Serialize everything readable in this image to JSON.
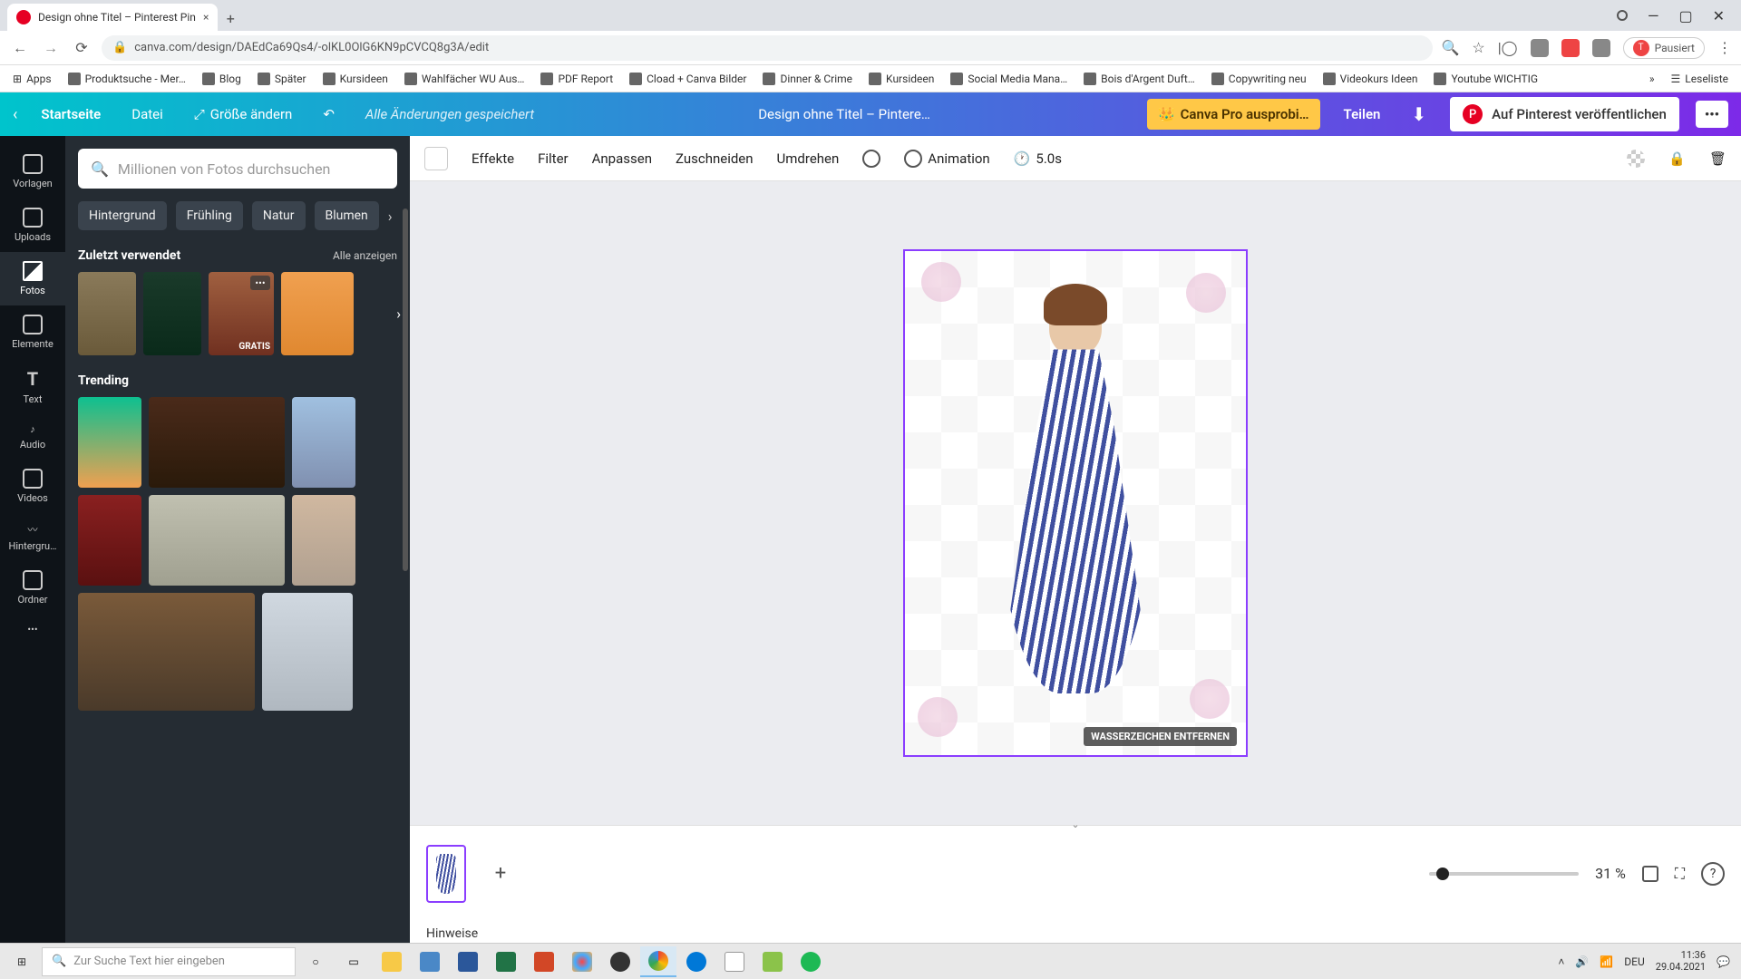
{
  "browser": {
    "tab_title": "Design ohne Titel – Pinterest Pin",
    "url": "canva.com/design/DAEdCa69Qs4/-olKL0OlG6KN9pCVCQ8g3A/edit",
    "pause_label": "Pausiert",
    "bookmarks": [
      "Apps",
      "Produktsuche - Mer…",
      "Blog",
      "Später",
      "Kursideen",
      "Wahlfächer WU Aus…",
      "PDF Report",
      "Cload + Canva Bilder",
      "Dinner & Crime",
      "Kursideen",
      "Social Media Mana…",
      "Bois d'Argent Duft…",
      "Copywriting neu",
      "Videokurs Ideen",
      "Youtube WICHTIG"
    ],
    "bm_right": "Leseliste"
  },
  "canva": {
    "home": "Startseite",
    "file": "Datei",
    "resize": "Größe ändern",
    "save_status": "Alle Änderungen gespeichert",
    "doc_title": "Design ohne Titel – Pintere…",
    "pro": "Canva Pro ausprobi…",
    "share": "Teilen",
    "publish": "Auf Pinterest veröffentlichen",
    "rail": {
      "templates": "Vorlagen",
      "uploads": "Uploads",
      "photos": "Fotos",
      "elements": "Elemente",
      "text": "Text",
      "audio": "Audio",
      "videos": "Videos",
      "background": "Hintergru…",
      "folder": "Ordner"
    },
    "panel": {
      "search_placeholder": "Millionen von Fotos durchsuchen",
      "chips": [
        "Hintergrund",
        "Frühling",
        "Natur",
        "Blumen"
      ],
      "recent_title": "Zuletzt verwendet",
      "see_all": "Alle anzeigen",
      "gratis": "GRATIS",
      "trending_title": "Trending"
    },
    "toolbar": {
      "effects": "Effekte",
      "filter": "Filter",
      "adjust": "Anpassen",
      "crop": "Zuschneiden",
      "flip": "Umdrehen",
      "animation": "Animation",
      "duration": "5.0s"
    },
    "watermark": "WASSERZEICHEN ENTFERNEN",
    "footer": {
      "hints": "Hinweise",
      "zoom_pct": "31 %"
    }
  },
  "taskbar": {
    "search_placeholder": "Zur Suche Text hier eingeben",
    "lang": "DEU",
    "time": "11:36",
    "date": "29.04.2021"
  }
}
